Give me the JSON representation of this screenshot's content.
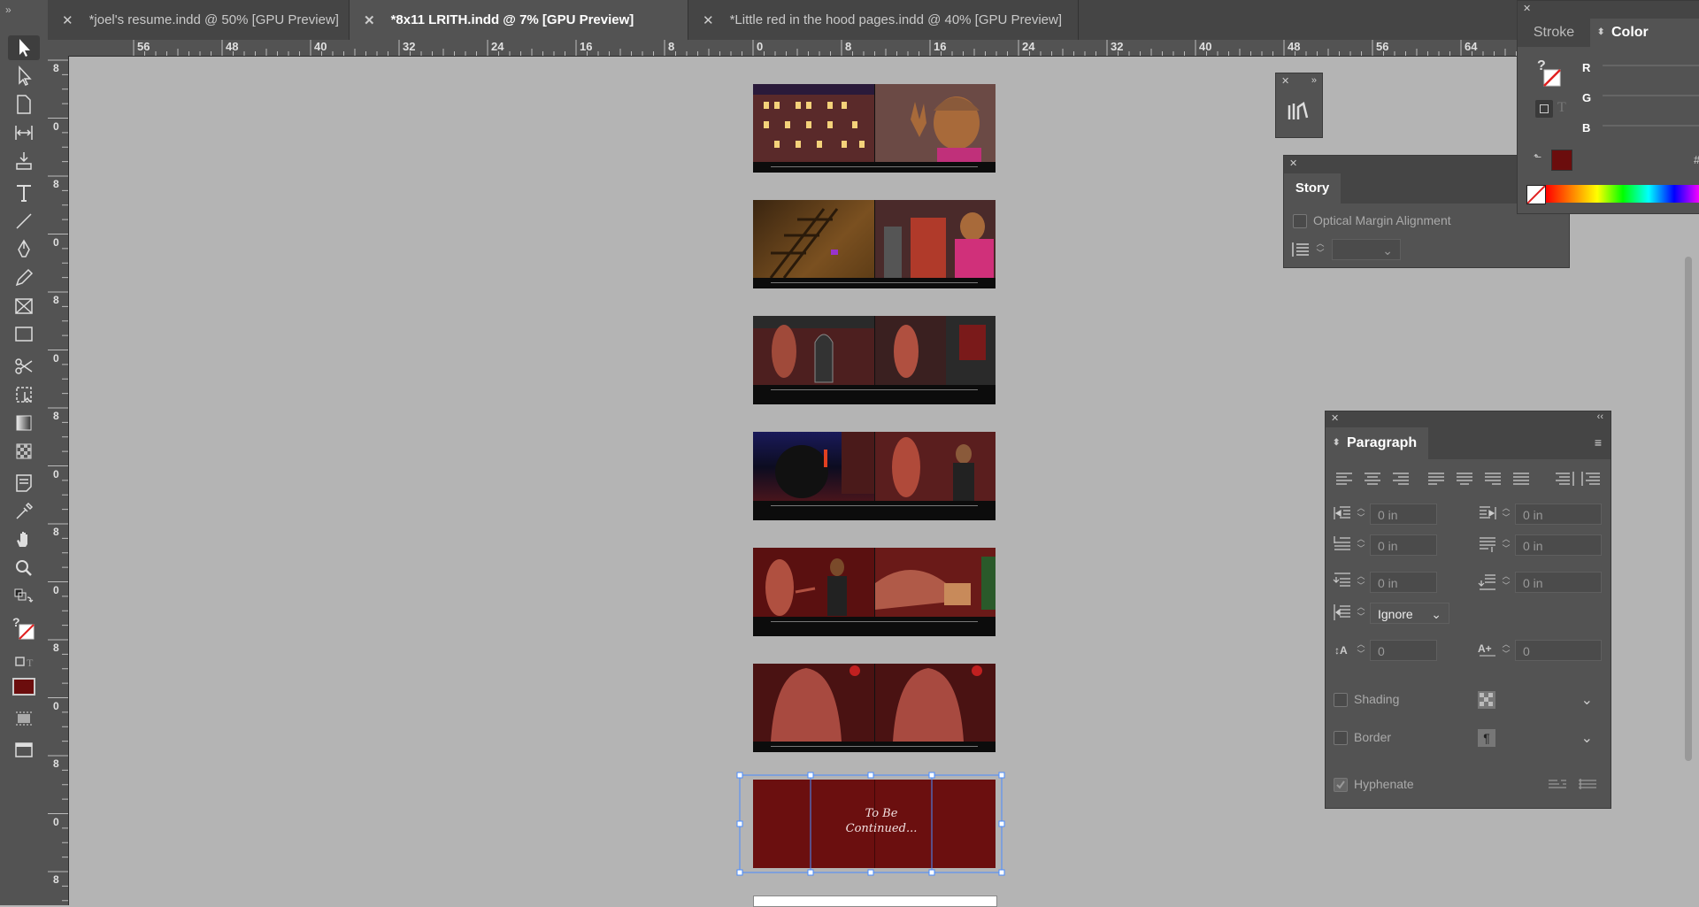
{
  "tabs": [
    {
      "label": "*joel's resume.indd @ 50% [GPU Preview]",
      "active": false
    },
    {
      "label": "*8x11 LRITH.indd @ 7% [GPU Preview]",
      "active": true
    },
    {
      "label": "*Little red in the hood pages.indd @ 40% [GPU Preview]",
      "active": false
    }
  ],
  "ruler": {
    "h_labels": [
      "56",
      "48",
      "40",
      "32",
      "24",
      "16",
      "8",
      "0",
      "8",
      "16",
      "24",
      "32",
      "40",
      "48",
      "56",
      "64"
    ],
    "v_labels": [
      "8",
      "0",
      "8",
      "0",
      "8",
      "0",
      "8",
      "0",
      "8",
      "0",
      "8",
      "0",
      "8",
      "0",
      "8"
    ]
  },
  "spreads": [
    {
      "name": "spread-1",
      "left": "#4a2a2a",
      "right": "#6a4a45"
    },
    {
      "name": "spread-2",
      "left": "#6b4a25",
      "right": "#7a2a2a"
    },
    {
      "name": "spread-3",
      "left": "#4d1f1f",
      "right": "#5a2525"
    },
    {
      "name": "spread-4",
      "left": "#1b1b3a",
      "right": "#5a1e1e"
    },
    {
      "name": "spread-5",
      "left": "#6a1616",
      "right": "#7a2a24"
    },
    {
      "name": "spread-6",
      "left": "#5a1515",
      "right": "#5a1515"
    },
    {
      "name": "spread-7",
      "left": "#6b0f0f",
      "right": "#6b0f0f"
    }
  ],
  "end_page": {
    "line1": "To Be",
    "line2": "Continued..."
  },
  "color_panel": {
    "tabs": [
      "Stroke",
      "Color"
    ],
    "channels": [
      "R",
      "G",
      "B"
    ],
    "hash": "#",
    "fill_color": "#6b0d0d"
  },
  "story_panel": {
    "title": "Story",
    "optical_margin": "Optical Margin Alignment"
  },
  "paragraph_panel": {
    "title": "Paragraph",
    "fields": [
      "0 in",
      "0 in",
      "0 in",
      "0 in",
      "0 in",
      "0 in"
    ],
    "align_to_grid": "Ignore",
    "drop_cap_lines": "0",
    "drop_cap_chars": "0",
    "shading": "Shading",
    "border": "Border",
    "hyphenate": "Hyphenate"
  }
}
